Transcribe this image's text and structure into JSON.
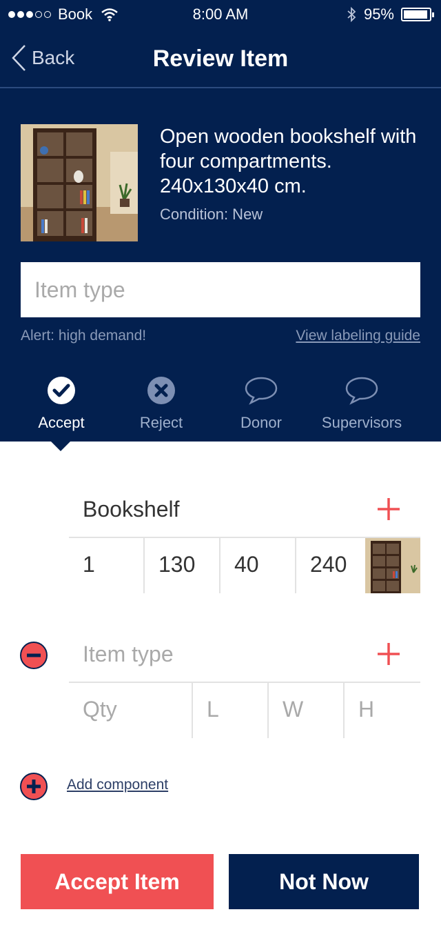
{
  "status_bar": {
    "carrier": "Book",
    "time": "8:00 AM",
    "battery": "95%",
    "battery_level": 0.95
  },
  "nav": {
    "back_label": "Back",
    "title": "Review Item"
  },
  "item": {
    "description": "Open wooden bookshelf with four compartments. 240x130x40 cm.",
    "condition": "Condition: New"
  },
  "type_field": {
    "placeholder": "Item type",
    "value": ""
  },
  "alert": "Alert: high demand!",
  "guide_link": "View labeling guide",
  "tabs": [
    {
      "label": "Accept",
      "icon": "check-circle-icon",
      "active": true
    },
    {
      "label": "Reject",
      "icon": "x-circle-icon",
      "active": false
    },
    {
      "label": "Donor",
      "icon": "chat-bubble-icon",
      "active": false
    },
    {
      "label": "Supervisors",
      "icon": "chat-bubble-icon",
      "active": false
    }
  ],
  "components": [
    {
      "name": "Bookshelf",
      "qty": "1",
      "length": "130",
      "width": "40",
      "height": "240"
    },
    {
      "name_placeholder": "Item type",
      "qty_placeholder": "Qty",
      "l_placeholder": "L",
      "w_placeholder": "W",
      "h_placeholder": "H"
    }
  ],
  "add_component": "Add component",
  "buttons": {
    "accept": "Accept Item",
    "not_now": "Not Now"
  },
  "colors": {
    "navy": "#03204f",
    "accent_red": "#f05053",
    "muted_text": "#8a9ab8"
  }
}
